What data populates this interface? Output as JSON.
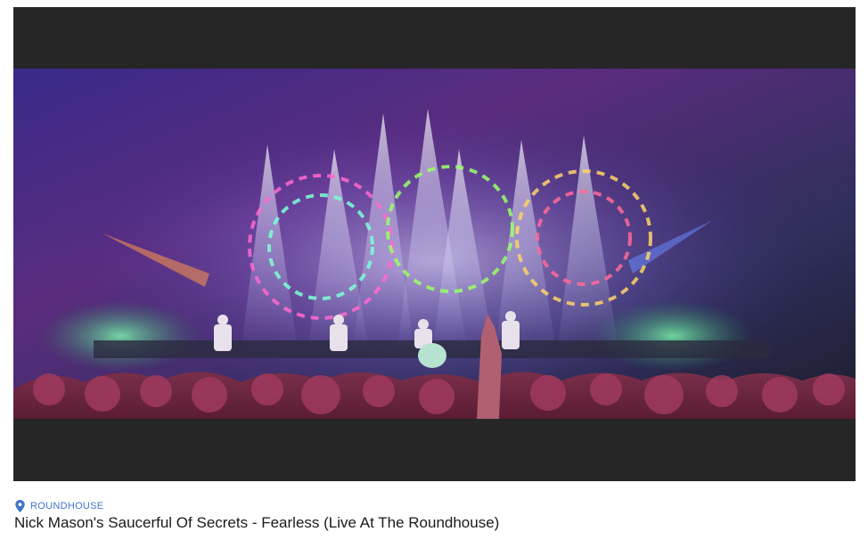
{
  "video": {
    "thumbnail_description_icon": "concert-stage-frame",
    "colors": {
      "letterbox": "#262626",
      "location_text": "#3f74c9",
      "title_text": "#1a1a1a"
    }
  },
  "location": {
    "icon": "map-pin-icon",
    "label": "ROUNDHOUSE"
  },
  "title": "Nick Mason's Saucerful Of Secrets - Fearless (Live At The Roundhouse)"
}
